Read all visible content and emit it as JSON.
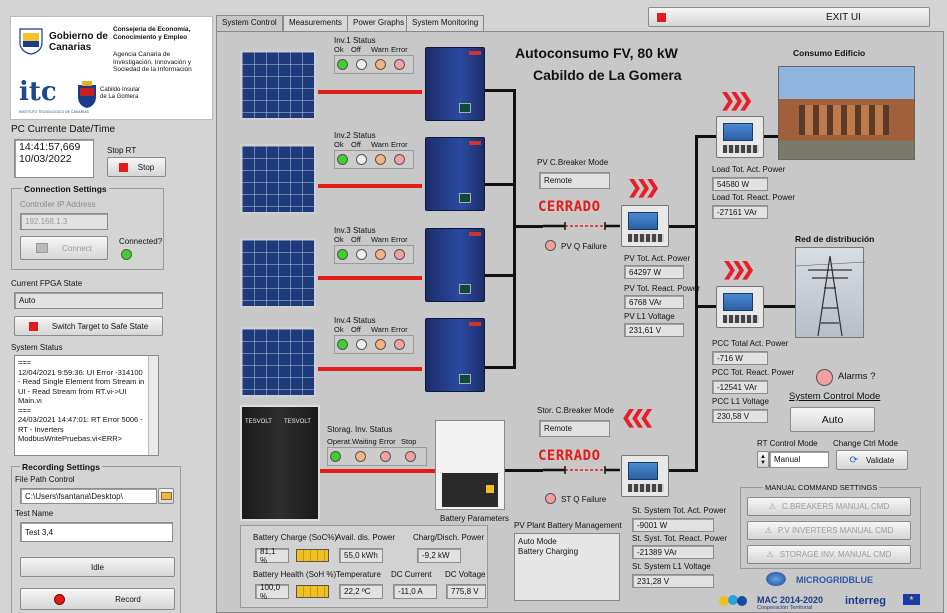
{
  "logos": {
    "gobierno": "Gobierno de Canarias",
    "consejeria": "Consejería de Economía, Conocimiento y Empleo",
    "agencia": "Agencia Canaria de Investigación, Innovación y Sociedad de la Información",
    "itc": "itc",
    "itc_sub": "INSTITUTO TECNOLÓGICO DE CANARIAS",
    "cabildo": "Cabildo Insular de La Gomera"
  },
  "left": {
    "pc_date_label": "PC Currente Date/Time",
    "time": "14:41:57,669",
    "date": "10/03/2022",
    "stop_rt_label": "Stop RT",
    "stop_button": "Stop",
    "conn_settings": "Connection Settings",
    "ip_label": "Controller IP Address",
    "ip_value": "192.168.1.3",
    "connect_button": "Connect",
    "connected_label": "Connected?",
    "fpga_label": "Current FPGA State",
    "fpga_value": "Auto",
    "switch_button": "Switch Target to Safe State",
    "system_status_label": "System Status",
    "system_status_text": "===\n12/04/2021 9:59:36: UI Error -314100 - Read Single Element from Stream in UI - Read Stream from RT.vi->UI Main.vi\n===\n24/03/2021 14:47:01: RT Error 5006 - RT - Inverters ModbusWritePruebas.vi<ERR>",
    "recording_settings": "Recording Settings",
    "file_path_label": "File Path Control",
    "file_path": "C:\\Users\\fsantana\\Desktop\\",
    "test_name_label": "Test Name",
    "test_name": "Test 3,4",
    "idle_button": "Idle",
    "record_button": "Record"
  },
  "tabs": [
    "System Control",
    "Measurements",
    "Power Graphs",
    "System Monitoring"
  ],
  "exit_button": "EXIT UI",
  "title_line1": "Autoconsumo FV, 80 kW",
  "title_line2": "Cabildo de La Gomera",
  "inverters": [
    {
      "title": "Inv.1 Status",
      "labels": [
        "Ok",
        "Off",
        "Warn",
        "Error"
      ]
    },
    {
      "title": "Inv.2 Status",
      "labels": [
        "Ok",
        "Off",
        "Warn",
        "Error"
      ]
    },
    {
      "title": "Inv.3 Status",
      "labels": [
        "Ok",
        "Off",
        "Warn",
        "Error"
      ]
    },
    {
      "title": "Inv.4 Status",
      "labels": [
        "Ok",
        "Off",
        "Warn",
        "Error"
      ]
    }
  ],
  "storage": {
    "title": "Storag. Inv. Status",
    "labels": [
      "Operat.",
      "Waiting",
      "Error",
      "Stop"
    ],
    "tesvolt": "TESVOLT",
    "battery_params": "Battery Parameters"
  },
  "pv_breaker": {
    "label": "PV C.Breaker Mode",
    "mode": "Remote",
    "state": "CERRADO",
    "failure": "PV Q Failure"
  },
  "st_breaker": {
    "label": "Stor. C.Breaker Mode",
    "mode": "Remote",
    "state": "CERRADO",
    "failure": "ST Q Failure"
  },
  "pv_meas": {
    "act_label": "PV Tot. Act. Power",
    "act": "64297 W",
    "react_label": "PV Tot. React. Power",
    "react": "6768 VAr",
    "volt_label": "PV L1 Voltage",
    "volt": "231,61 V"
  },
  "load": {
    "title": "Consumo Edificio",
    "act_label": "Load Tot. Act. Power",
    "act": "54580 W",
    "react_label": "Load Tot. React. Power",
    "react": "-27161 VAr"
  },
  "grid": {
    "title": "Red de distribución",
    "act_label": "PCC Total Act. Power",
    "act": "-716 W",
    "react_label": "PCC Tot. React. Power",
    "react": "-12541 VAr",
    "volt_label": "PCC L1 Voltage",
    "volt": "230,58 V"
  },
  "alarms_label": "Alarms ?",
  "system_control_mode": {
    "label": "System Control Mode",
    "value": "Auto"
  },
  "rt_control": {
    "label": "RT Control Mode",
    "value": "Manual"
  },
  "change_ctrl": {
    "label": "Change Ctrl Mode",
    "button": "Validate"
  },
  "manual_cmd": {
    "title": "MANUAL COMMAND SETTINGS",
    "buttons": [
      "C.BREAKERS MANUAL CMD",
      "P.V INVERTERS MANUAL CMD",
      "STORAGE INV. MANUAL CMD"
    ]
  },
  "battery": {
    "charge_label": "Battery Charge (SoC%)",
    "charge": "81,1 %",
    "avail_label": "Avail. dis. Power",
    "avail": "55,0 kWh",
    "chdis_label": "Charg/Disch. Power",
    "chdis": "-9,2 kW",
    "health_label": "Battery Health (SoH %)",
    "health": "100,0 %",
    "temp_label": "Temperature",
    "temp": "22,2 ºC",
    "dcc_label": "DC Current",
    "dcc": "-11,0 A",
    "dcv_label": "DC Voltage",
    "dcv": "775,8 V"
  },
  "pv_plant": {
    "label": "PV Plant Battery Management",
    "lines": [
      "Auto Mode",
      "Battery Charging"
    ]
  },
  "st_meas": {
    "act_label": "St. System Tot. Act. Power",
    "act": "-9001 W",
    "react_label": "St. Syst. Tot. React. Power",
    "react": "-21389 VAr",
    "volt_label": "St. System L1 Voltage",
    "volt": "231,28 V"
  },
  "footer": {
    "microgrid": "MICROGRIDBLUE",
    "mac": "MAC 2014-2020",
    "mac_sub": "Cooperación Territorial",
    "interreg": "interreg"
  },
  "colors": {
    "led_green": "#3fcf2f",
    "led_pink": "#f5a0a0",
    "led_orange": "#f6b37f",
    "red": "#e41b1b"
  }
}
